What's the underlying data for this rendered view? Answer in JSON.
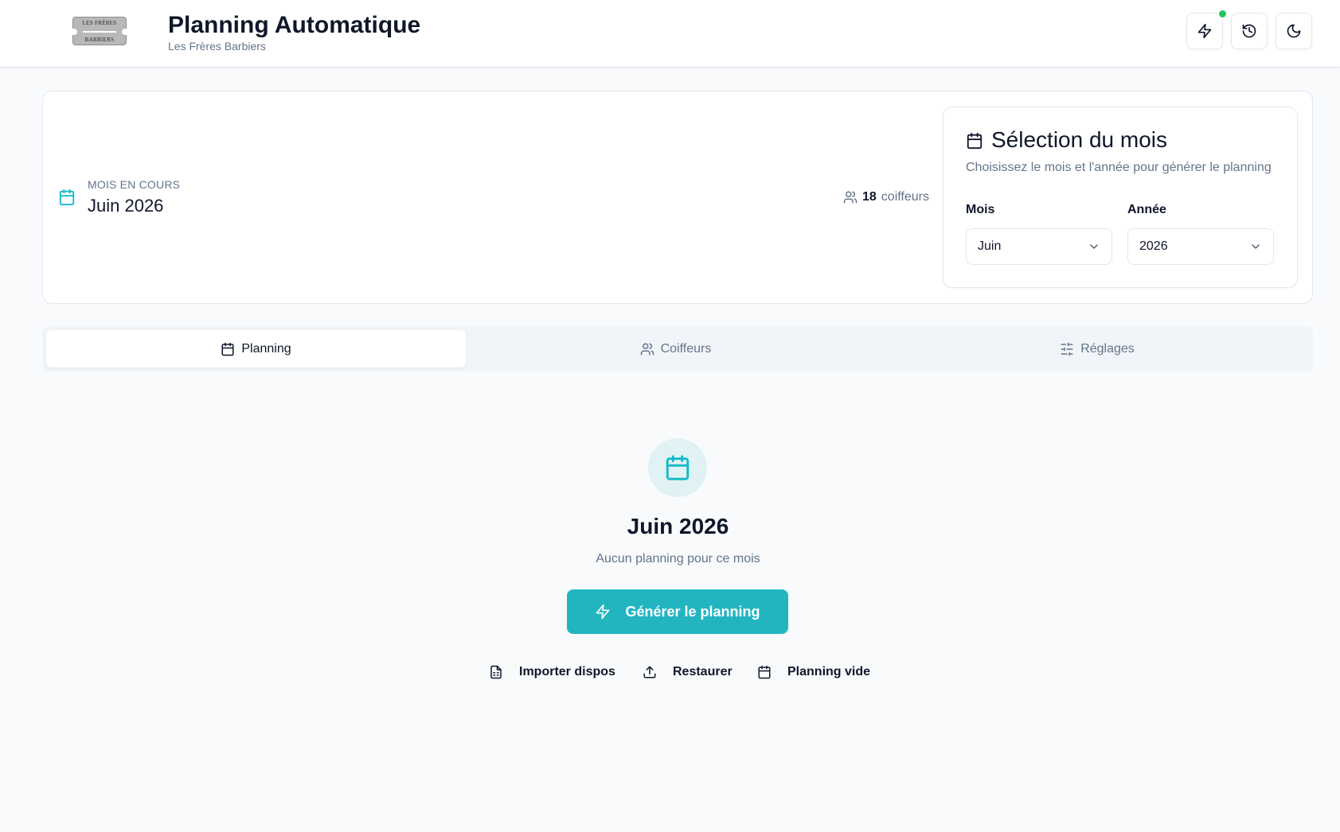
{
  "header": {
    "logo_text_top": "LES FRÈRES",
    "logo_text_bottom": "BARBIERS",
    "title": "Planning Automatique",
    "subtitle": "Les Frères Barbiers",
    "buttons": [
      {
        "icon": "lightning-icon"
      },
      {
        "icon": "history-icon"
      },
      {
        "icon": "moon-icon"
      }
    ],
    "status_color": "#22c55e"
  },
  "summary": {
    "current_label": "MOIS EN COURS",
    "current_value": "Juin 2026",
    "barber_count": "18",
    "barber_count_label": "coiffeurs"
  },
  "month_selector": {
    "title": "Sélection du mois",
    "description": "Choisissez le mois et l'année pour générer le planning",
    "month_label": "Mois",
    "month_value": "Juin",
    "year_label": "Année",
    "year_value": "2026"
  },
  "tabs": [
    {
      "label": "Planning",
      "icon": "calendar-icon",
      "active": true
    },
    {
      "label": "Coiffeurs",
      "icon": "users-icon",
      "active": false
    },
    {
      "label": "Réglages",
      "icon": "sliders-icon",
      "active": false
    }
  ],
  "empty_state": {
    "title": "Juin 2026",
    "subtitle": "Aucun planning pour ce mois",
    "generate_label": "Générer le planning",
    "actions": [
      {
        "label": "Importer dispos",
        "icon": "file-spreadsheet-icon"
      },
      {
        "label": "Restaurer",
        "icon": "upload-icon"
      },
      {
        "label": "Planning vide",
        "icon": "calendar-icon"
      }
    ]
  },
  "colors": {
    "accent": "#22b5c0",
    "accent_icon": "#14b8c8",
    "background": "#f8fafc",
    "muted_text": "#64748b"
  }
}
